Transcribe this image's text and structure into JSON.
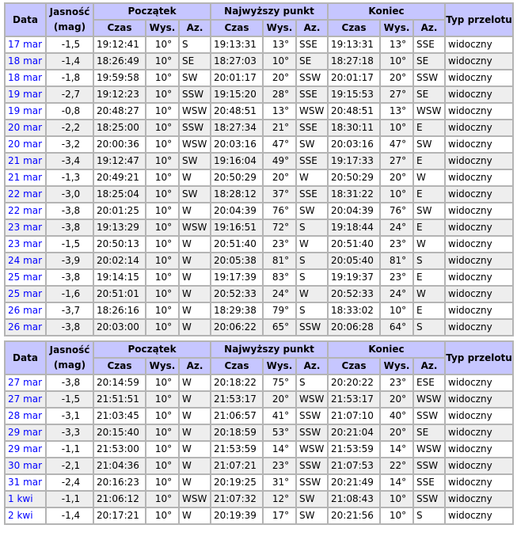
{
  "headers": {
    "date": "Data",
    "mag_top": "Jasność",
    "mag_bottom": "(mag)",
    "start": "Początek",
    "highest": "Najwyższy punkt",
    "end": "Koniec",
    "type": "Typ przelotu",
    "time": "Czas",
    "alt": "Wys.",
    "az": "Az."
  },
  "tables": [
    {
      "rows": [
        [
          "17 mar",
          "-1,5",
          "19:12:41",
          "10°",
          "S",
          "19:13:31",
          "13°",
          "SSE",
          "19:13:31",
          "13°",
          "SSE",
          "widoczny"
        ],
        [
          "18 mar",
          "-1,4",
          "18:26:49",
          "10°",
          "SE",
          "18:27:03",
          "10°",
          "SE",
          "18:27:18",
          "10°",
          "SE",
          "widoczny"
        ],
        [
          "18 mar",
          "-1,8",
          "19:59:58",
          "10°",
          "SW",
          "20:01:17",
          "20°",
          "SSW",
          "20:01:17",
          "20°",
          "SSW",
          "widoczny"
        ],
        [
          "19 mar",
          "-2,7",
          "19:12:23",
          "10°",
          "SSW",
          "19:15:20",
          "28°",
          "SSE",
          "19:15:53",
          "27°",
          "SE",
          "widoczny"
        ],
        [
          "19 mar",
          "-0,8",
          "20:48:27",
          "10°",
          "WSW",
          "20:48:51",
          "13°",
          "WSW",
          "20:48:51",
          "13°",
          "WSW",
          "widoczny"
        ],
        [
          "20 mar",
          "-2,2",
          "18:25:00",
          "10°",
          "SSW",
          "18:27:34",
          "21°",
          "SSE",
          "18:30:11",
          "10°",
          "E",
          "widoczny"
        ],
        [
          "20 mar",
          "-3,2",
          "20:00:36",
          "10°",
          "WSW",
          "20:03:16",
          "47°",
          "SW",
          "20:03:16",
          "47°",
          "SW",
          "widoczny"
        ],
        [
          "21 mar",
          "-3,4",
          "19:12:47",
          "10°",
          "SW",
          "19:16:04",
          "49°",
          "SSE",
          "19:17:33",
          "27°",
          "E",
          "widoczny"
        ],
        [
          "21 mar",
          "-1,3",
          "20:49:21",
          "10°",
          "W",
          "20:50:29",
          "20°",
          "W",
          "20:50:29",
          "20°",
          "W",
          "widoczny"
        ],
        [
          "22 mar",
          "-3,0",
          "18:25:04",
          "10°",
          "SW",
          "18:28:12",
          "37°",
          "SSE",
          "18:31:22",
          "10°",
          "E",
          "widoczny"
        ],
        [
          "22 mar",
          "-3,8",
          "20:01:25",
          "10°",
          "W",
          "20:04:39",
          "76°",
          "SW",
          "20:04:39",
          "76°",
          "SW",
          "widoczny"
        ],
        [
          "23 mar",
          "-3,8",
          "19:13:29",
          "10°",
          "WSW",
          "19:16:51",
          "72°",
          "S",
          "19:18:44",
          "24°",
          "E",
          "widoczny"
        ],
        [
          "23 mar",
          "-1,5",
          "20:50:13",
          "10°",
          "W",
          "20:51:40",
          "23°",
          "W",
          "20:51:40",
          "23°",
          "W",
          "widoczny"
        ],
        [
          "24 mar",
          "-3,9",
          "20:02:14",
          "10°",
          "W",
          "20:05:38",
          "81°",
          "S",
          "20:05:40",
          "81°",
          "S",
          "widoczny"
        ],
        [
          "25 mar",
          "-3,8",
          "19:14:15",
          "10°",
          "W",
          "19:17:39",
          "83°",
          "S",
          "19:19:37",
          "23°",
          "E",
          "widoczny"
        ],
        [
          "25 mar",
          "-1,6",
          "20:51:01",
          "10°",
          "W",
          "20:52:33",
          "24°",
          "W",
          "20:52:33",
          "24°",
          "W",
          "widoczny"
        ],
        [
          "26 mar",
          "-3,7",
          "18:26:16",
          "10°",
          "W",
          "18:29:38",
          "79°",
          "S",
          "18:33:02",
          "10°",
          "E",
          "widoczny"
        ],
        [
          "26 mar",
          "-3,8",
          "20:03:00",
          "10°",
          "W",
          "20:06:22",
          "65°",
          "SSW",
          "20:06:28",
          "64°",
          "S",
          "widoczny"
        ]
      ]
    },
    {
      "rows": [
        [
          "27 mar",
          "-3,8",
          "20:14:59",
          "10°",
          "W",
          "20:18:22",
          "75°",
          "S",
          "20:20:22",
          "23°",
          "ESE",
          "widoczny"
        ],
        [
          "27 mar",
          "-1,5",
          "21:51:51",
          "10°",
          "W",
          "21:53:17",
          "20°",
          "WSW",
          "21:53:17",
          "20°",
          "WSW",
          "widoczny"
        ],
        [
          "28 mar",
          "-3,1",
          "21:03:45",
          "10°",
          "W",
          "21:06:57",
          "41°",
          "SSW",
          "21:07:10",
          "40°",
          "SSW",
          "widoczny"
        ],
        [
          "29 mar",
          "-3,3",
          "20:15:40",
          "10°",
          "W",
          "20:18:59",
          "53°",
          "SSW",
          "20:21:04",
          "20°",
          "SE",
          "widoczny"
        ],
        [
          "29 mar",
          "-1,1",
          "21:53:00",
          "10°",
          "W",
          "21:53:59",
          "14°",
          "WSW",
          "21:53:59",
          "14°",
          "WSW",
          "widoczny"
        ],
        [
          "30 mar",
          "-2,1",
          "21:04:36",
          "10°",
          "W",
          "21:07:21",
          "23°",
          "SSW",
          "21:07:53",
          "22°",
          "SSW",
          "widoczny"
        ],
        [
          "31 mar",
          "-2,4",
          "20:16:23",
          "10°",
          "W",
          "20:19:25",
          "31°",
          "SSW",
          "20:21:49",
          "14°",
          "SSE",
          "widoczny"
        ],
        [
          "1 kwi",
          "-1,1",
          "21:06:12",
          "10°",
          "WSW",
          "21:07:32",
          "12°",
          "SW",
          "21:08:43",
          "10°",
          "SSW",
          "widoczny"
        ],
        [
          "2 kwi",
          "-1,4",
          "20:17:21",
          "10°",
          "W",
          "20:19:39",
          "17°",
          "SW",
          "20:21:56",
          "10°",
          "S",
          "widoczny"
        ]
      ]
    }
  ]
}
